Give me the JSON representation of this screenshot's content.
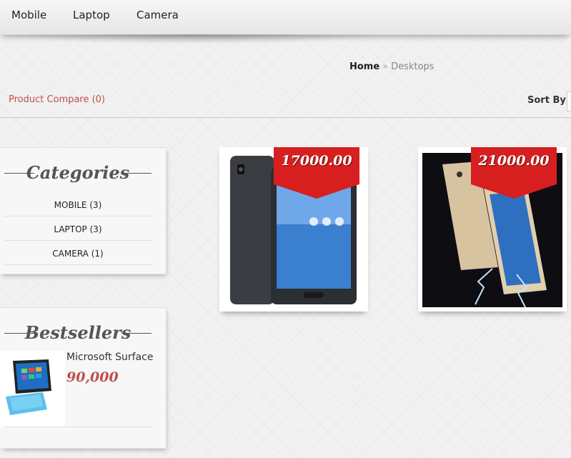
{
  "nav": {
    "items": [
      "Mobile",
      "Laptop",
      "Camera"
    ]
  },
  "breadcrumb": {
    "home": "Home",
    "separator": "»",
    "current": "Desktops"
  },
  "toolbar": {
    "compare": "Product Compare (0)",
    "sort_label": "Sort By:"
  },
  "categories": {
    "title": "Categories",
    "items": [
      "MOBILE (3)",
      "LAPTOP (3)",
      "CAMERA (1)"
    ]
  },
  "bestsellers": {
    "title": "Bestsellers",
    "items": [
      {
        "name": "Microsoft Surface",
        "price": "90,000"
      }
    ]
  },
  "products": [
    {
      "price": "17000.00",
      "image": "black-asus-phone"
    },
    {
      "price": "21000.00",
      "image": "gold-asus-phone"
    }
  ],
  "colors": {
    "accent": "#c0504d",
    "price_flag": "#d81f1f"
  }
}
